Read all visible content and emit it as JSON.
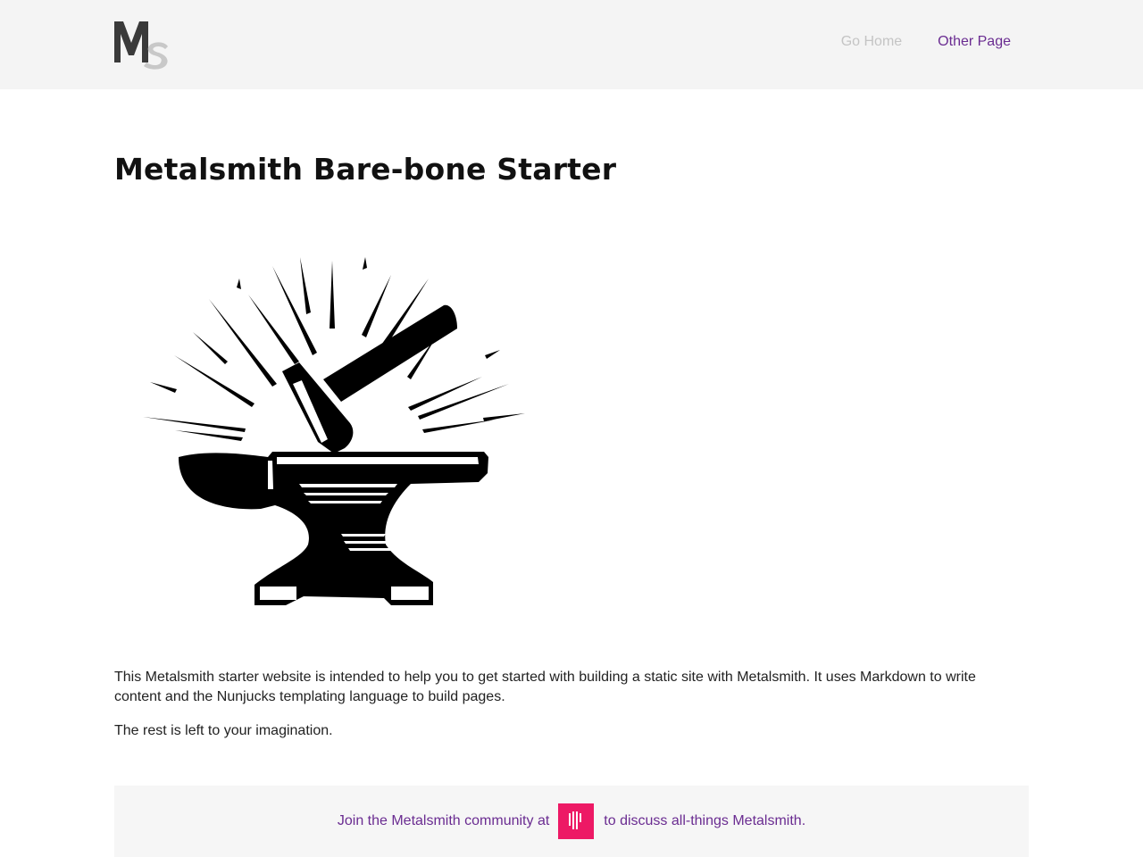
{
  "header": {
    "logo": {
      "text": "MS",
      "icon": "metalsmith-logo-icon",
      "colors": {
        "m": "#3a3a3a",
        "s": "#c8c8c8"
      }
    },
    "nav": [
      {
        "label": "Go Home",
        "color": "#c4c4c4"
      },
      {
        "label": "Other Page",
        "color": "#6a2c91"
      }
    ]
  },
  "main": {
    "title": "Metalsmith Bare-bone Starter",
    "hero_image": "anvil-hammer-illustration",
    "paragraphs": [
      "This Metalsmith starter website is intended to help you to get started with building a static site with Metalsmith. It uses Markdown to write content and the Nunjucks templating language to build pages.",
      "The rest is left to your imagination."
    ]
  },
  "community": {
    "prefix": "Join the Metalsmith community at",
    "icon": "gitter-icon",
    "suffix": "to discuss all-things Metalsmith.",
    "accent_color": "#ed1965",
    "text_color": "#6a2c91"
  }
}
